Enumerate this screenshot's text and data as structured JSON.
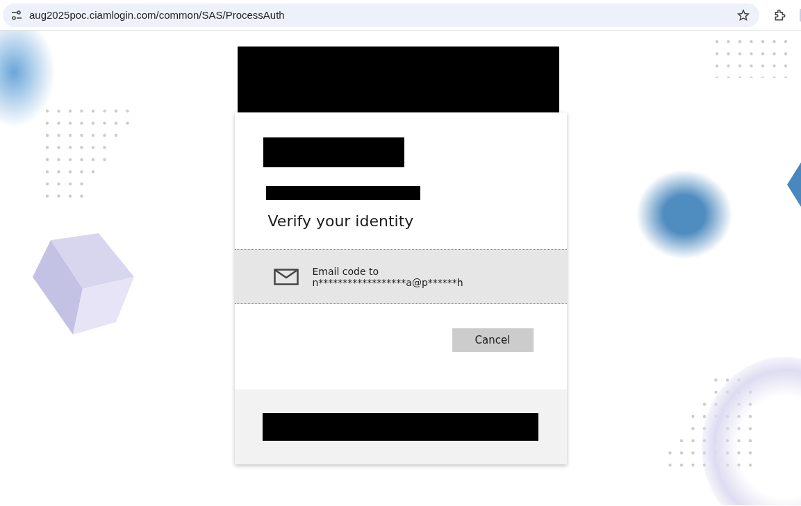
{
  "browser": {
    "url": "aug2025poc.ciamlogin.com/common/SAS/ProcessAuth"
  },
  "card": {
    "title": "Verify your identity",
    "options": [
      {
        "kind": "email",
        "label": "Email code to",
        "address": "n******************a@p******h"
      }
    ],
    "buttons": [
      {
        "label": "Cancel"
      }
    ]
  }
}
